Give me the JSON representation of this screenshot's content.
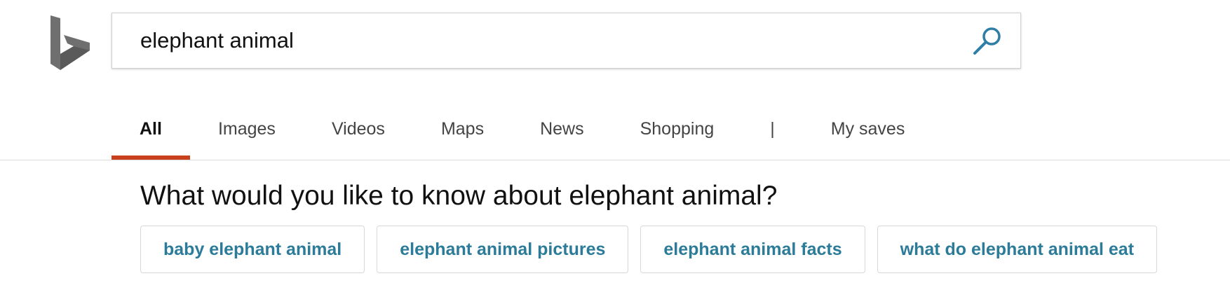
{
  "search": {
    "query": "elephant animal"
  },
  "tabs": [
    {
      "label": "All"
    },
    {
      "label": "Images"
    },
    {
      "label": "Videos"
    },
    {
      "label": "Maps"
    },
    {
      "label": "News"
    },
    {
      "label": "Shopping"
    },
    {
      "label": "|"
    },
    {
      "label": "My saves"
    }
  ],
  "active_tab": "All",
  "related": {
    "heading": "What would you like to know about elephant animal?",
    "chips": [
      {
        "label": "baby elephant animal"
      },
      {
        "label": "elephant animal pictures"
      },
      {
        "label": "elephant animal facts"
      },
      {
        "label": "what do elephant animal eat"
      }
    ]
  },
  "colors": {
    "accent_underline": "#c8401c",
    "chip_text": "#2b7b99",
    "search_icon": "#2f7ea8",
    "logo": "#6f6f6f"
  },
  "icons": {
    "logo": "bing-logo-icon",
    "search": "search-icon"
  }
}
